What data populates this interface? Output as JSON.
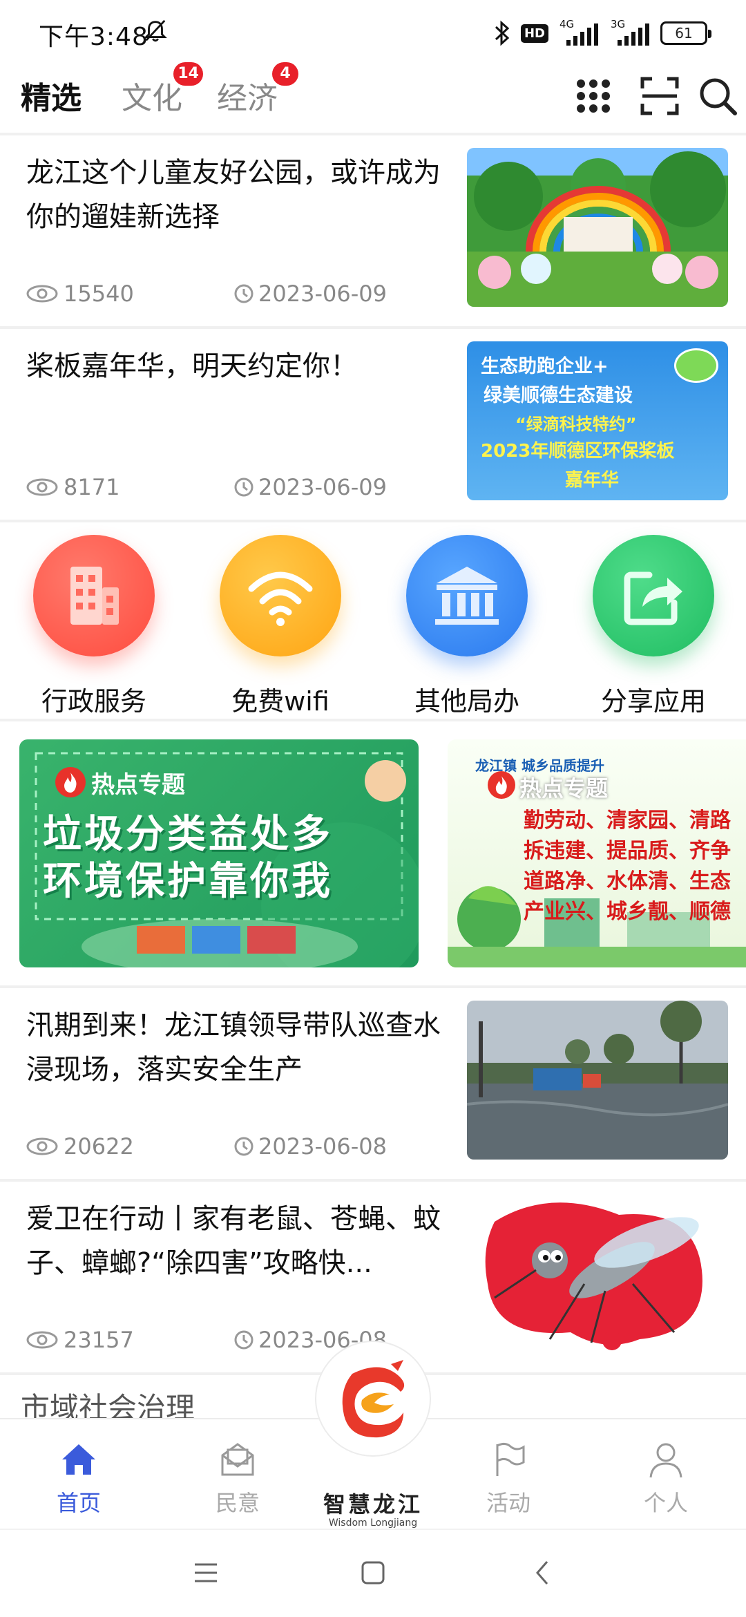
{
  "status_bar": {
    "time": "下午3:48",
    "hd": "HD",
    "network_1": "4G",
    "network_2": "3G",
    "battery": "61"
  },
  "top_nav": {
    "tabs": [
      {
        "label": "精选"
      },
      {
        "label": "文化",
        "badge": "14"
      },
      {
        "label": "经济",
        "badge": "4"
      }
    ],
    "icons": [
      "apps-grid-icon",
      "scan-icon",
      "search-icon"
    ]
  },
  "news": [
    {
      "title": "龙江这个儿童友好公园，或许成为你的遛娃新选择",
      "views": "15540",
      "date": "2023-06-09"
    },
    {
      "title": "桨板嘉年华，明天约定你！",
      "views": "8171",
      "date": "2023-06-09",
      "thumb_lines": [
        "生态助跑企业+",
        "绿美顺德生态建设",
        "“绿滴科技特约”",
        "2023年顺德区环保桨板",
        "嘉年华"
      ]
    },
    {
      "title": "汛期到来！龙江镇领导带队巡查水浸现场，落实安全生产",
      "views": "20622",
      "date": "2023-06-08"
    },
    {
      "title": "爱卫在行动丨家有老鼠、苍蝇、蚊子、蟑螂?“除四害”攻略快...",
      "views": "23157",
      "date": "2023-06-08"
    }
  ],
  "services": [
    {
      "label": "行政服务",
      "icon": "building-icon",
      "color": "#ff5a4e"
    },
    {
      "label": "免费wifi",
      "icon": "wifi-icon",
      "color": "#ffb21e"
    },
    {
      "label": "其他局办",
      "icon": "bank-icon",
      "color": "#2f86f6"
    },
    {
      "label": "分享应用",
      "icon": "share-icon",
      "color": "#2fc86e"
    }
  ],
  "banners": [
    {
      "tag": "热点专题",
      "lines": [
        "垃圾分类益处多",
        "环境保护靠你我"
      ]
    },
    {
      "tag": "热点专题",
      "header": "龙江镇 城乡品质提升",
      "lines": [
        "勤劳动、清家园、清路",
        "拆违建、提品质、齐争",
        "道路净、水体清、生态",
        "产业兴、城乡靓、顺德"
      ]
    }
  ],
  "section_title": "市域社会治理",
  "bottom_nav": {
    "items": [
      {
        "label": "首页",
        "icon": "home-icon"
      },
      {
        "label": "民意",
        "icon": "mail-icon"
      },
      {
        "label": "活动",
        "icon": "flag-icon"
      },
      {
        "label": "个人",
        "icon": "person-icon"
      }
    ],
    "brand_cn": "智慧龙江",
    "brand_en": "Wisdom Longjiang"
  }
}
